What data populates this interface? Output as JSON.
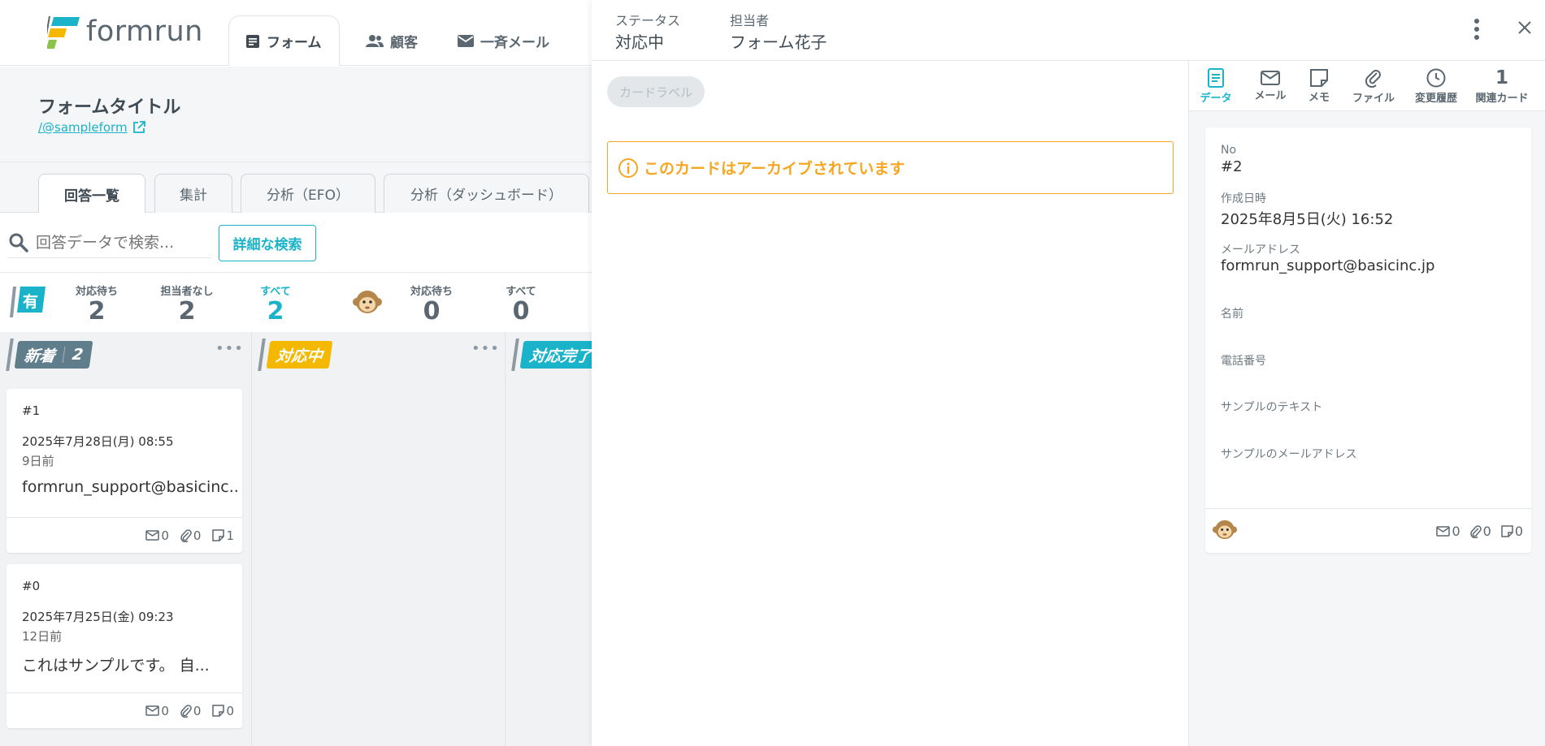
{
  "app": {
    "logo_text": "formrun",
    "nav": {
      "form": "フォーム",
      "customers": "顧客",
      "bulk_mail": "一斉メール"
    }
  },
  "form": {
    "title": "フォームタイトル",
    "link": "/@sampleform"
  },
  "subtabs": [
    "回答一覧",
    "集計",
    "分析（EFO）",
    "分析（ダッシュボード）"
  ],
  "search": {
    "placeholder": "回答データで検索...",
    "advanced": "詳細な検索"
  },
  "filters": {
    "group1_badge": "有",
    "group1": [
      {
        "label": "対応待ち",
        "count": "2"
      },
      {
        "label": "担当者なし",
        "count": "2"
      },
      {
        "label": "すべて",
        "count": "2"
      }
    ],
    "group2": [
      {
        "label": "対応待ち",
        "count": "0"
      },
      {
        "label": "すべて",
        "count": "0"
      }
    ]
  },
  "columns": [
    {
      "label": "新着",
      "count": "2",
      "color": "#607d8b",
      "menu": "•••"
    },
    {
      "label": "対応中",
      "color": "#f5b800",
      "menu": "•••"
    },
    {
      "label": "対応完了",
      "color": "#1ab3c9"
    }
  ],
  "cards": [
    {
      "no": "#1",
      "date": "2025年7月28日(月) 08:55",
      "ago": "9日前",
      "main": "formrun_support@basicinc...",
      "mail": "0",
      "file": "0",
      "memo": "1"
    },
    {
      "no": "#0",
      "date": "2025年7月25日(金) 09:23",
      "ago": "12日前",
      "main": "これはサンプルです。 自...",
      "mail": "0",
      "file": "0",
      "memo": "0"
    }
  ],
  "panel": {
    "status_label": "ステータス",
    "status_value": "対応中",
    "assignee_label": "担当者",
    "assignee_value": "フォーム花子",
    "card_label_button": "カードラベル",
    "archived_message": "このカードはアーカイブされています",
    "side_tabs": {
      "data": "データ",
      "mail": "メール",
      "memo": "メモ",
      "file": "ファイル",
      "history": "変更履歴",
      "related": "関連カード",
      "related_count": "1"
    },
    "fields": [
      {
        "label": "No",
        "value": "#2"
      },
      {
        "label": "作成日時",
        "value": "2025年8月5日(火) 16:52"
      },
      {
        "label": "メールアドレス",
        "value": "formrun_support@basicinc.jp"
      },
      {
        "label": "名前",
        "value": ""
      },
      {
        "label": "電話番号",
        "value": ""
      },
      {
        "label": "サンプルのテキスト",
        "value": ""
      },
      {
        "label": "サンプルのメールアドレス",
        "value": ""
      }
    ],
    "footer_counts": {
      "mail": "0",
      "file": "0",
      "memo": "0"
    }
  },
  "colors": {
    "accent": "#1ab3c9",
    "warning": "#f5a623",
    "new": "#607d8b",
    "in_progress": "#f5b800"
  }
}
